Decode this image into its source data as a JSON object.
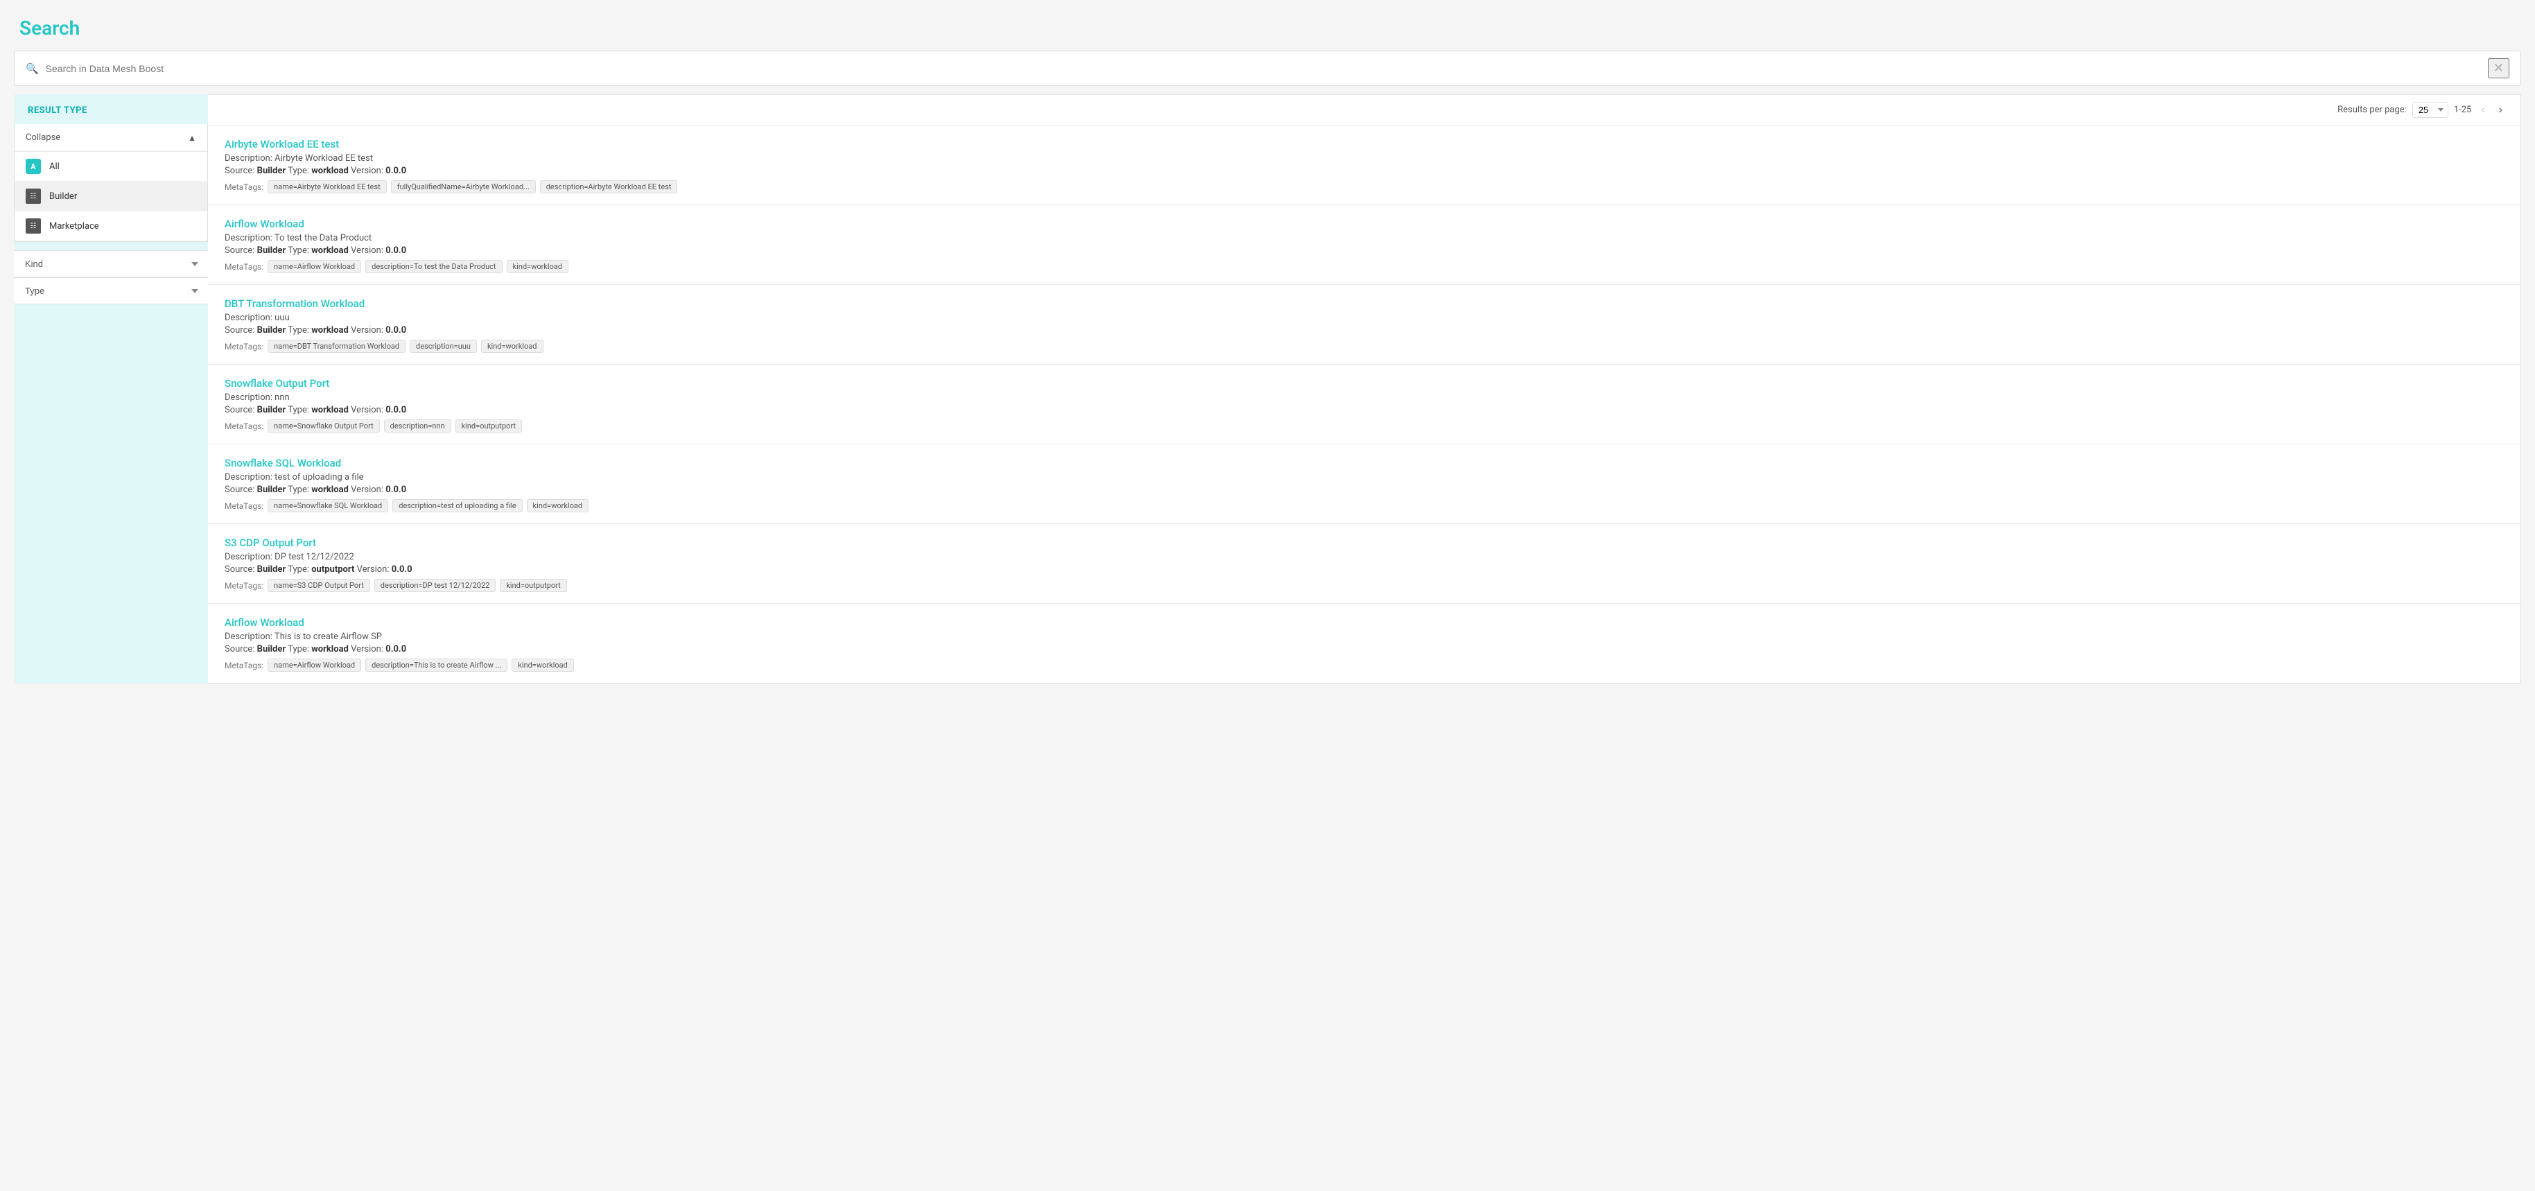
{
  "page": {
    "title": "Search"
  },
  "searchBar": {
    "placeholder": "Search in Data Mesh Boost",
    "value": ""
  },
  "sidebar": {
    "resultTypeLabel": "RESULT TYPE",
    "collapseLabel": "Collapse",
    "filterItems": [
      {
        "id": "all",
        "label": "All",
        "icon": "A",
        "active": false
      },
      {
        "id": "builder",
        "label": "Builder",
        "icon": "☰",
        "active": true
      },
      {
        "id": "marketplace",
        "label": "Marketplace",
        "icon": "☰",
        "active": false
      }
    ],
    "kindDropdown": {
      "label": "Kind",
      "options": [
        "Kind"
      ]
    },
    "typeDropdown": {
      "label": "Type",
      "options": [
        "Type"
      ]
    }
  },
  "results": {
    "perPageLabel": "Results per page:",
    "perPage": "25",
    "range": "1-25",
    "items": [
      {
        "title": "Airbyte Workload EE test",
        "description": "Description: Airbyte Workload EE test",
        "source": "Builder",
        "type": "workload",
        "version": "0.0.0",
        "tags": [
          "name=Airbyte Workload EE test",
          "fullyQualifiedName=Airbyte Workload...",
          "description=Airbyte Workload EE test"
        ]
      },
      {
        "title": "Airflow Workload",
        "description": "Description: To test the Data Product",
        "source": "Builder",
        "type": "workload",
        "version": "0.0.0",
        "tags": [
          "name=Airflow Workload",
          "description=To test the Data Product",
          "kind=workload"
        ]
      },
      {
        "title": "DBT Transformation Workload",
        "description": "Description: uuu",
        "source": "Builder",
        "type": "workload",
        "version": "0.0.0",
        "tags": [
          "name=DBT Transformation Workload",
          "description=uuu",
          "kind=workload"
        ]
      },
      {
        "title": "Snowflake Output Port",
        "description": "Description: nnn",
        "source": "Builder",
        "type": "workload",
        "version": "0.0.0",
        "tags": [
          "name=Snowflake Output Port",
          "description=nnn",
          "kind=outputport"
        ]
      },
      {
        "title": "Snowflake SQL Workload",
        "description": "Description: test of uploading a file",
        "source": "Builder",
        "type": "workload",
        "version": "0.0.0",
        "tags": [
          "name=Snowflake SQL Workload",
          "description=test of uploading a file",
          "kind=workload"
        ]
      },
      {
        "title": "S3 CDP Output Port",
        "description": "Description: DP test 12/12/2022",
        "source": "Builder",
        "type": "outputport",
        "version": "0.0.0",
        "tags": [
          "name=S3 CDP Output Port",
          "description=DP test 12/12/2022",
          "kind=outputport"
        ]
      },
      {
        "title": "Airflow Workload",
        "description": "Description: This is to create Airflow SP",
        "source": "Builder",
        "type": "workload",
        "version": "0.0.0",
        "tags": [
          "name=Airflow Workload",
          "description=This is to create Airflow ...",
          "kind=workload"
        ]
      }
    ]
  }
}
